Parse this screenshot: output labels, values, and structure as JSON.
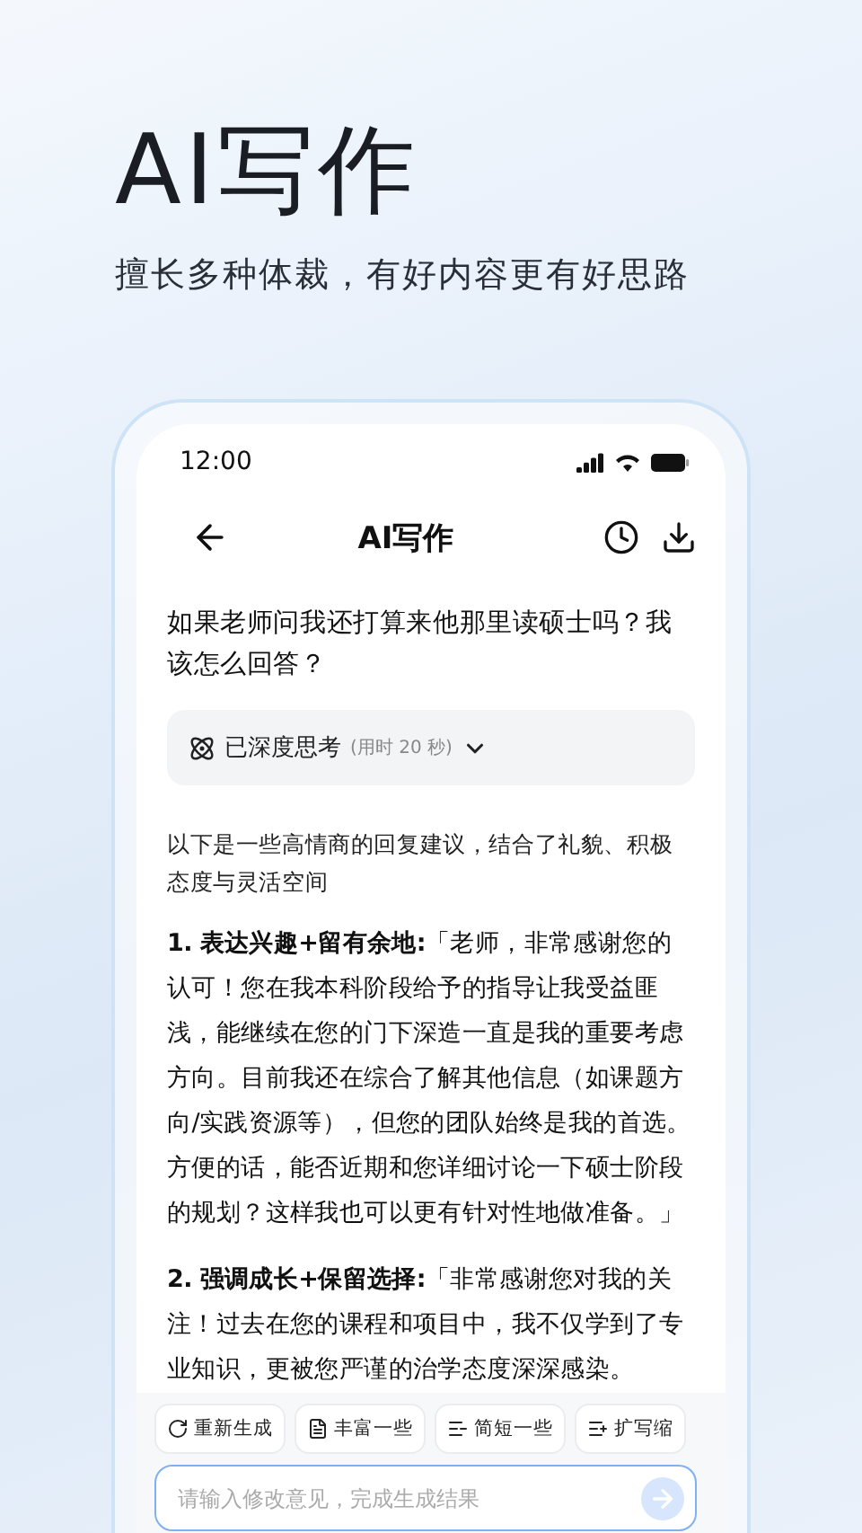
{
  "hero": {
    "title": "AI写作",
    "subtitle": "擅长多种体裁，有好内容更有好思路"
  },
  "status_bar": {
    "time": "12:00"
  },
  "nav": {
    "title": "AI写作"
  },
  "question": "如果老师问我还打算来他那里读硕士吗？我该怎么回答？",
  "thinking": {
    "label": "已深度思考",
    "duration": "(用时 20 秒)",
    "expanded": false
  },
  "answer": {
    "intro": "以下是一些高情商的回复建议，结合了礼貌、积极态度与灵活空间",
    "points": [
      {
        "heading": "1. 表达兴趣+留有余地:",
        "body": "「老师，非常感谢您的认可！您在我本科阶段给予的指导让我受益匪浅，能继续在您的门下深造一直是我的重要考虑方向。目前我还在综合了解其他信息（如课题方向/实践资源等），但您的团队始终是我的首选。方便的话，能否近期和您详细讨论一下硕士阶段的规划？这样我也可以更有针对性地做准备。」"
      },
      {
        "heading": "2. 强调成长+保留选择:",
        "body": "「非常感谢您对我的关注！过去在您的课程和项目中，我不仅学到了专业知识，更被您严谨的治学态度深深感染。"
      }
    ]
  },
  "actions": [
    {
      "kind": "regenerate",
      "label": "重新生成"
    },
    {
      "kind": "enrich",
      "label": "丰富一些"
    },
    {
      "kind": "shorten",
      "label": "简短一些"
    },
    {
      "kind": "expand",
      "label": "扩写缩"
    }
  ],
  "input": {
    "placeholder": "请输入修改意见，完成生成结果"
  }
}
